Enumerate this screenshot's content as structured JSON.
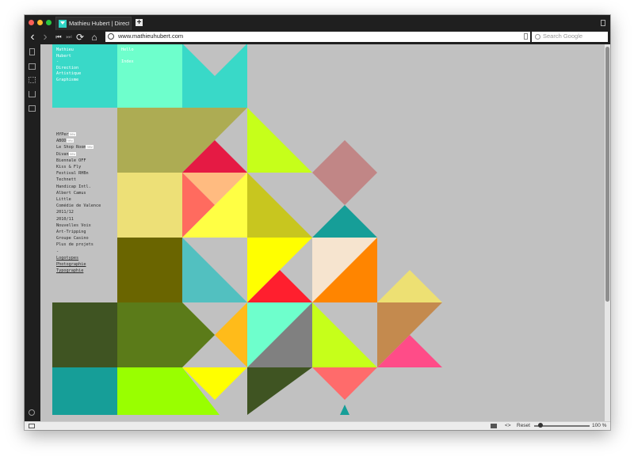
{
  "window": {
    "tab_title": "Mathieu Hubert | Direction",
    "new_tab_label": "+"
  },
  "navigation": {
    "back": "‹",
    "forward": "›",
    "rewind": "⏮",
    "fast_forward": "⏭",
    "reload": "⟳",
    "home": "⌂",
    "url": "www.mathieuhubert.com",
    "search_placeholder": "Search Google"
  },
  "site": {
    "identity_lines": [
      "Mathieu",
      "Hubert",
      "-",
      "Direction",
      "Artistique",
      "Graphisme"
    ],
    "contact_lines": [
      "Hello",
      "",
      "Index"
    ],
    "projects": [
      {
        "label": "HYPer",
        "new": "new"
      },
      {
        "label": "ABOD",
        "new": "new"
      },
      {
        "label": "Le Shop Room",
        "new": "new"
      },
      {
        "label": "Divan",
        "new": "new"
      },
      {
        "label": "Biennale OFF"
      },
      {
        "label": "Kiss & Fly"
      },
      {
        "label": "Festival RHBn"
      },
      {
        "label": "Technett"
      },
      {
        "label": "Handicap Intl."
      },
      {
        "label": "Albert Camus"
      },
      {
        "label": "Little"
      },
      {
        "label": "Comédie de Valence"
      },
      {
        "label": "2011/12"
      },
      {
        "label": "2010/11"
      },
      {
        "label": "Nouvelles Voix"
      },
      {
        "label": "Art-Tripping"
      },
      {
        "label": "Groupe Casino"
      },
      {
        "label": "Plus de projets"
      },
      {
        "label": "-"
      }
    ],
    "categories": [
      "Logotypes",
      "Photographie",
      "Typographie"
    ]
  },
  "status": {
    "reset_label": "Reset",
    "zoom": "100 %"
  },
  "colors": {
    "chrome_dark": "#1f1f1f",
    "page_bg": "#c1c1c1",
    "accent_teal": "#2fd3c4"
  }
}
